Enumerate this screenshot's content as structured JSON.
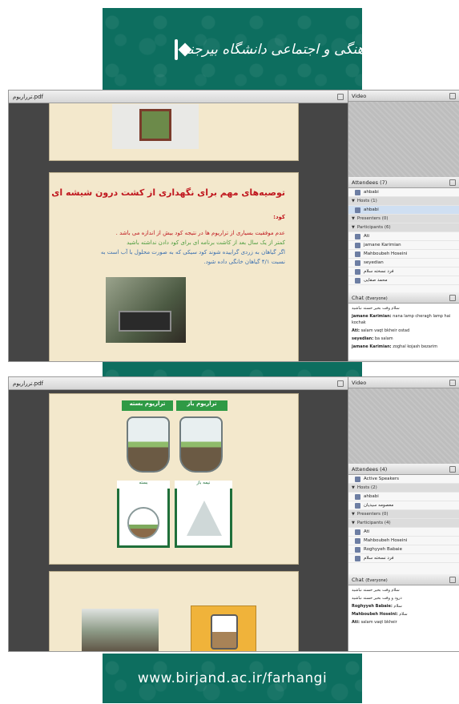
{
  "banner_top": {
    "logo_text": "معاونت فرهنگی و اجتماعی دانشگاه بیرجند"
  },
  "banner_bottom": {
    "url": "www.birjand.ac.ir/farhangi"
  },
  "shot1": {
    "share_title": "ترراریوم.pdf",
    "video_title": "Video",
    "attendees_title": "Attendees",
    "attendees_count": "(7)",
    "attendees": [
      {
        "kind": "self",
        "name": "ahbabi"
      },
      {
        "kind": "group",
        "name": "Hosts (1)"
      },
      {
        "kind": "person",
        "name": "ahbabi",
        "selected": true
      },
      {
        "kind": "group",
        "name": "Presenters (0)"
      },
      {
        "kind": "group",
        "name": "Participants (6)"
      },
      {
        "kind": "person",
        "name": "Ati"
      },
      {
        "kind": "person",
        "name": "jamane Karimian"
      },
      {
        "kind": "person",
        "name": "Mahboubeh Hoseini"
      },
      {
        "kind": "person",
        "name": "seyedian"
      },
      {
        "kind": "person",
        "name": "فرد نسخته سلام"
      },
      {
        "kind": "person",
        "name": "محمد صفایی"
      }
    ],
    "chat_title": "Chat",
    "chat_scope": "(Everyone)",
    "chat": [
      {
        "who": "",
        "text": "سلام وقت بخیر خسته نباشید"
      },
      {
        "who": "jamane Karimian:",
        "text": "nana lamp cheragh lamp hai kochak"
      },
      {
        "who": "Ati:",
        "text": "salam vaqt bkheir ostad"
      },
      {
        "who": "seyedian:",
        "text": "ba salam"
      },
      {
        "who": "jamane Karimian:",
        "text": "zoghal kojash bezarim"
      }
    ],
    "slide": {
      "title": "توصیه‌های مهم برای نگهداری از کشت درون شیشه ای",
      "heading": "کود:",
      "lines": [
        {
          "text": "عدم موفقیت بسیاری از تراریوم ها در نتیجه کود بیش از اندازه می باشد .",
          "color": "red"
        },
        {
          "text": "کمتر از یک سال بعد از کاشت برنامه ای برای کود دادن نداشته باشید",
          "color": "green"
        },
        {
          "text": "اگر گیاهان به زردی گراییده شوند کود سیکی که به صورت محلول با آب است به",
          "color": "blue"
        },
        {
          "text": "نسبت ۴/۱ گیاهان خانگی داده شود.",
          "color": "blue"
        }
      ]
    }
  },
  "shot2": {
    "share_title": "ترراریوم.pdf",
    "video_title": "Video",
    "attendees_title": "Attendees",
    "attendees_count": "(4)",
    "attendees": [
      {
        "kind": "self",
        "name": "Active Speakers"
      },
      {
        "kind": "group",
        "name": "Hosts (2)"
      },
      {
        "kind": "person",
        "name": "ahbabi"
      },
      {
        "kind": "person",
        "name": "معصومه سیدیان"
      },
      {
        "kind": "group",
        "name": "Presenters (0)"
      },
      {
        "kind": "group",
        "name": "Participants (4)"
      },
      {
        "kind": "person",
        "name": "Ati"
      },
      {
        "kind": "person",
        "name": "Mahboubeh Hoseini"
      },
      {
        "kind": "person",
        "name": "Roghyyeh Babaie"
      },
      {
        "kind": "person",
        "name": "فرد نسخته سلام"
      }
    ],
    "chat_title": "Chat",
    "chat_scope": "(Everyone)",
    "chat": [
      {
        "who": "",
        "text": "سلام وقت بخیر خسته نباشید"
      },
      {
        "who": "",
        "text": "درود و وقت بخیر خسته نباشید"
      },
      {
        "who": "Roghyyeh Babaie:",
        "text": "سلام"
      },
      {
        "who": "Mahboubeh Hoseini:",
        "text": "سلام"
      },
      {
        "who": "Ati:",
        "text": "salam vaqt bkheir"
      }
    ],
    "slide": {
      "label_open": "تراریوم باز",
      "label_closed": "تراریوم بسته",
      "label_half": "نیمه باز",
      "label_sealed": "بسته"
    }
  },
  "colors": {
    "banner": "#0d6e5f",
    "accent_red": "#c0181f",
    "accent_green": "#2f9a45"
  }
}
